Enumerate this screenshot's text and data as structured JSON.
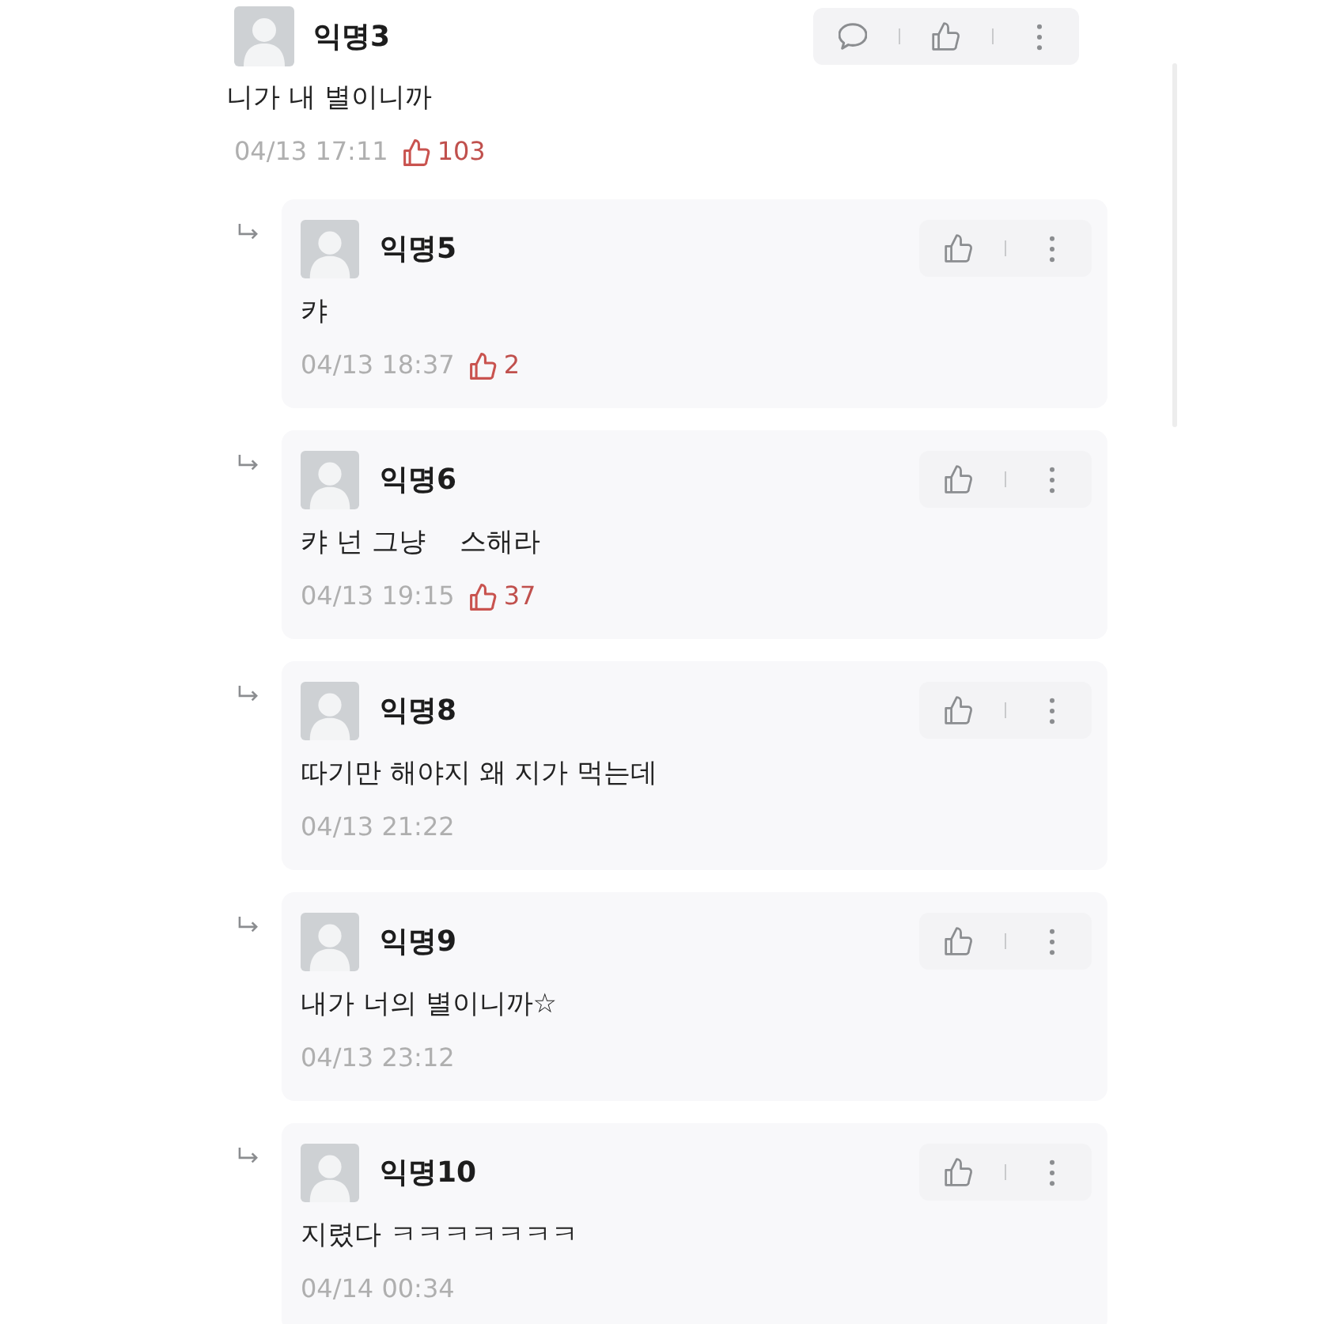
{
  "comment": {
    "author": "익명3",
    "text": "니가 내 별이니까",
    "time": "04/13 17:11",
    "likes": "103",
    "actions": [
      {
        "kind": "comment"
      },
      {
        "kind": "like"
      },
      {
        "kind": "more"
      }
    ],
    "replies": [
      {
        "author": "익명5",
        "text": "캬",
        "time": "04/13 18:37",
        "likes": "2",
        "actions": [
          {
            "kind": "like"
          },
          {
            "kind": "more"
          }
        ]
      },
      {
        "author": "익명6",
        "text": "캬 넌 그냥    스해라",
        "time": "04/13 19:15",
        "likes": "37",
        "actions": [
          {
            "kind": "like"
          },
          {
            "kind": "more"
          }
        ]
      },
      {
        "author": "익명8",
        "text": "따기만 해야지 왜 지가 먹는데",
        "time": "04/13 21:22",
        "actions": [
          {
            "kind": "like"
          },
          {
            "kind": "more"
          }
        ]
      },
      {
        "author": "익명9",
        "text": "내가 너의 별이니까☆",
        "time": "04/13 23:12",
        "actions": [
          {
            "kind": "like"
          },
          {
            "kind": "more"
          }
        ]
      },
      {
        "author": "익명10",
        "text": "지렸다 ㅋㅋㅋㅋㅋㅋㅋ",
        "time": "04/14 00:34",
        "actions": [
          {
            "kind": "like"
          },
          {
            "kind": "more"
          }
        ]
      }
    ]
  }
}
